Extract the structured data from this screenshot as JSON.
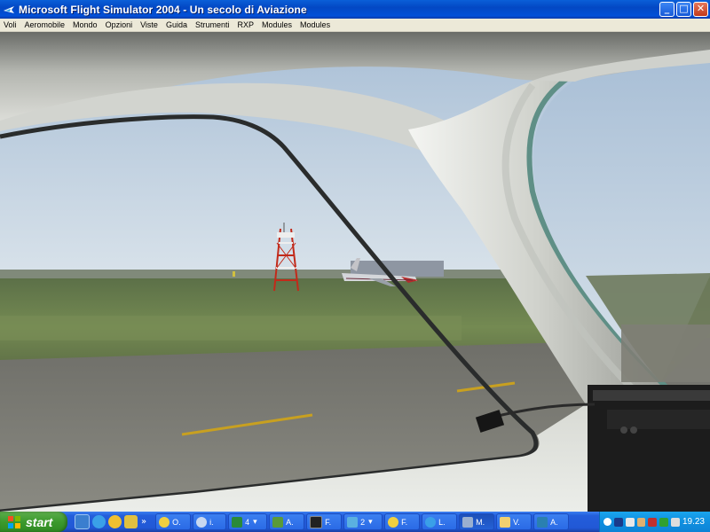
{
  "window": {
    "title": "Microsoft Flight Simulator 2004 - Un secolo di Aviazione",
    "icon": "fs2004-app-icon",
    "buttons": {
      "minimize": "_",
      "maximize": "□",
      "close": "✕"
    }
  },
  "menu": [
    {
      "label": "Voli"
    },
    {
      "label": "Aeromobile"
    },
    {
      "label": "Mondo"
    },
    {
      "label": "Opzioni"
    },
    {
      "label": "Viste"
    },
    {
      "label": "Guida"
    },
    {
      "label": "Strumenti"
    },
    {
      "label": "RXP"
    },
    {
      "label": "Modules"
    },
    {
      "label": "Modules"
    }
  ],
  "scene": {
    "description_icons": [
      "cockpit-frame",
      "radio-tower",
      "airliner"
    ],
    "colors": {
      "sky": "#c8d8e8",
      "grass": "#6a7d4e",
      "runway": "#7a7a72",
      "frame": "#e2e4e0",
      "runway_stripe": "#c8a020"
    }
  },
  "taskbar": {
    "start_label": "start",
    "quicklaunch": [
      "desktop-icon",
      "ie-icon",
      "media-icon",
      "outlook-icon"
    ],
    "overflow": "»",
    "tasks": [
      {
        "label": "O.",
        "icon": "task-icon-o"
      },
      {
        "label": "i.",
        "icon": "task-icon-i"
      },
      {
        "label": "4",
        "icon": "excel-icon",
        "dropdown": "▾"
      },
      {
        "label": "A.",
        "icon": "task-icon-a"
      },
      {
        "label": "F.",
        "icon": "task-icon-f"
      },
      {
        "label": "2",
        "icon": "explorer-icon",
        "dropdown": "▾"
      },
      {
        "label": "F.",
        "icon": "task-icon-f2"
      },
      {
        "label": "L.",
        "icon": "ie-task-icon"
      },
      {
        "label": "M.",
        "icon": "fs-task-icon",
        "active": true
      },
      {
        "label": "V.",
        "icon": "folder-icon"
      },
      {
        "label": "A.",
        "icon": "task-icon-a2"
      }
    ],
    "tray": {
      "icons": [
        "chevron-icon",
        "network-icon",
        "speaker-icon",
        "user-icon",
        "shield-icon",
        "color-icon",
        "volume-icon"
      ],
      "clock": "19.23"
    }
  }
}
